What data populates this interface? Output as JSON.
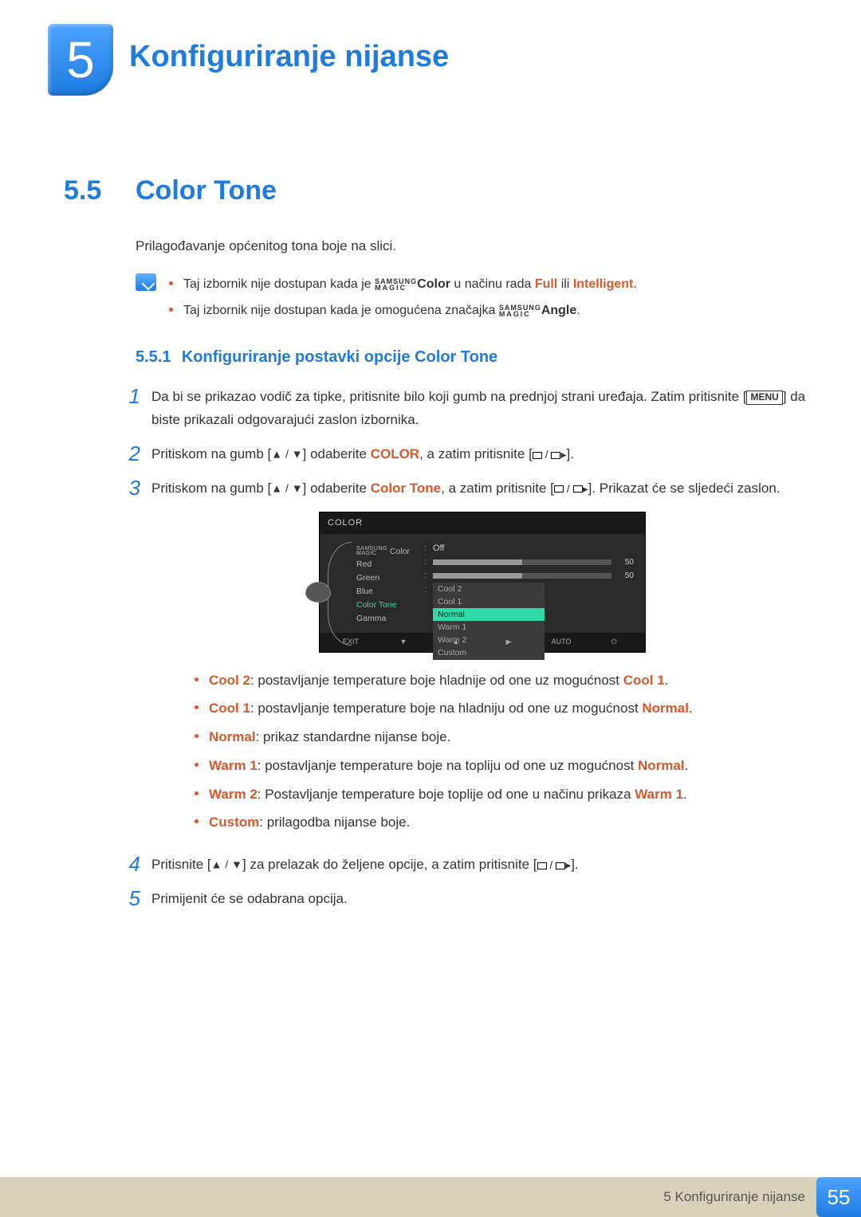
{
  "chapter": {
    "number": "5",
    "title": "Konfiguriranje nijanse"
  },
  "section": {
    "number": "5.5",
    "title": "Color Tone"
  },
  "intro": "Prilagođavanje općenitog tona boje na slici.",
  "notes": {
    "items": [
      {
        "pre": "Taj izbornik nije dostupan kada je ",
        "magic": "SAMSUNG MAGIC",
        "mid": "Color",
        "mid2": " u načinu rada ",
        "o1": "Full",
        "sep": " ili ",
        "o2": "Intelligent",
        "post": "."
      },
      {
        "pre": "Taj izbornik nije dostupan kada je omogućena značajka ",
        "magic": "SAMSUNG MAGIC",
        "mid": "Angle",
        "post": "."
      }
    ]
  },
  "subsection": {
    "number": "5.5.1",
    "title": "Konfiguriranje postavki opcije Color Tone"
  },
  "steps": {
    "s1": {
      "n": "1",
      "a": "Da bi se prikazao vodič za tipke, pritisnite bilo koji gumb na prednjoj strani uređaja. Zatim pritisnite [",
      "menu": "MENU",
      "b": "] da biste prikazali odgovarajući zaslon izbornika."
    },
    "s2": {
      "n": "2",
      "a": "Pritiskom na gumb [",
      "b": "] odaberite ",
      "c": "COLOR",
      "d": ", a zatim pritisnite [",
      "e": "]."
    },
    "s3": {
      "n": "3",
      "a": "Pritiskom na gumb [",
      "b": "] odaberite ",
      "c": "Color Tone",
      "d": ", a zatim pritisnite [",
      "e": "]. Prikazat će se sljedeći zaslon."
    },
    "s4": {
      "n": "4",
      "a": "Pritisnite [",
      "b": "] za prelazak do željene opcije, a zatim pritisnite [",
      "c": "]."
    },
    "s5": {
      "n": "5",
      "a": "Primijenit će se odabrana opcija."
    }
  },
  "osd": {
    "title": "COLOR",
    "menu": [
      "Color",
      "Red",
      "Green",
      "Blue",
      "Color Tone",
      "Gamma"
    ],
    "magic_prefix": "SAMSUNG MAGIC",
    "off": "Off",
    "slider_val": "50",
    "options": [
      "Cool 2",
      "Cool 1",
      "Normal",
      "Warm 1",
      "Warm 2",
      "Custom"
    ],
    "footer": [
      "EXIT",
      "▼",
      "▲",
      "▶",
      "AUTO",
      "⏻"
    ]
  },
  "bullets": [
    {
      "k": "Cool 2",
      "t": ": postavljanje temperature boje hladnije od one uz mogućnost ",
      "o": "Cool 1",
      "end": "."
    },
    {
      "k": "Cool 1",
      "t": ": postavljanje temperature boje na hladniju od one uz mogućnost ",
      "o": "Normal",
      "end": "."
    },
    {
      "k": "Normal",
      "t": ": prikaz standardne nijanse boje.",
      "o": "",
      "end": ""
    },
    {
      "k": "Warm 1",
      "t": ": postavljanje temperature boje na topliju od one uz mogućnost ",
      "o": "Normal",
      "end": "."
    },
    {
      "k": "Warm 2",
      "t": ": Postavljanje temperature boje toplije od one u načinu prikaza ",
      "o": "Warm 1",
      "end": "."
    },
    {
      "k": "Custom",
      "t": ": prilagodba nijanse boje.",
      "o": "",
      "end": ""
    }
  ],
  "footer": {
    "text": "5 Konfiguriranje nijanse",
    "page": "55"
  }
}
